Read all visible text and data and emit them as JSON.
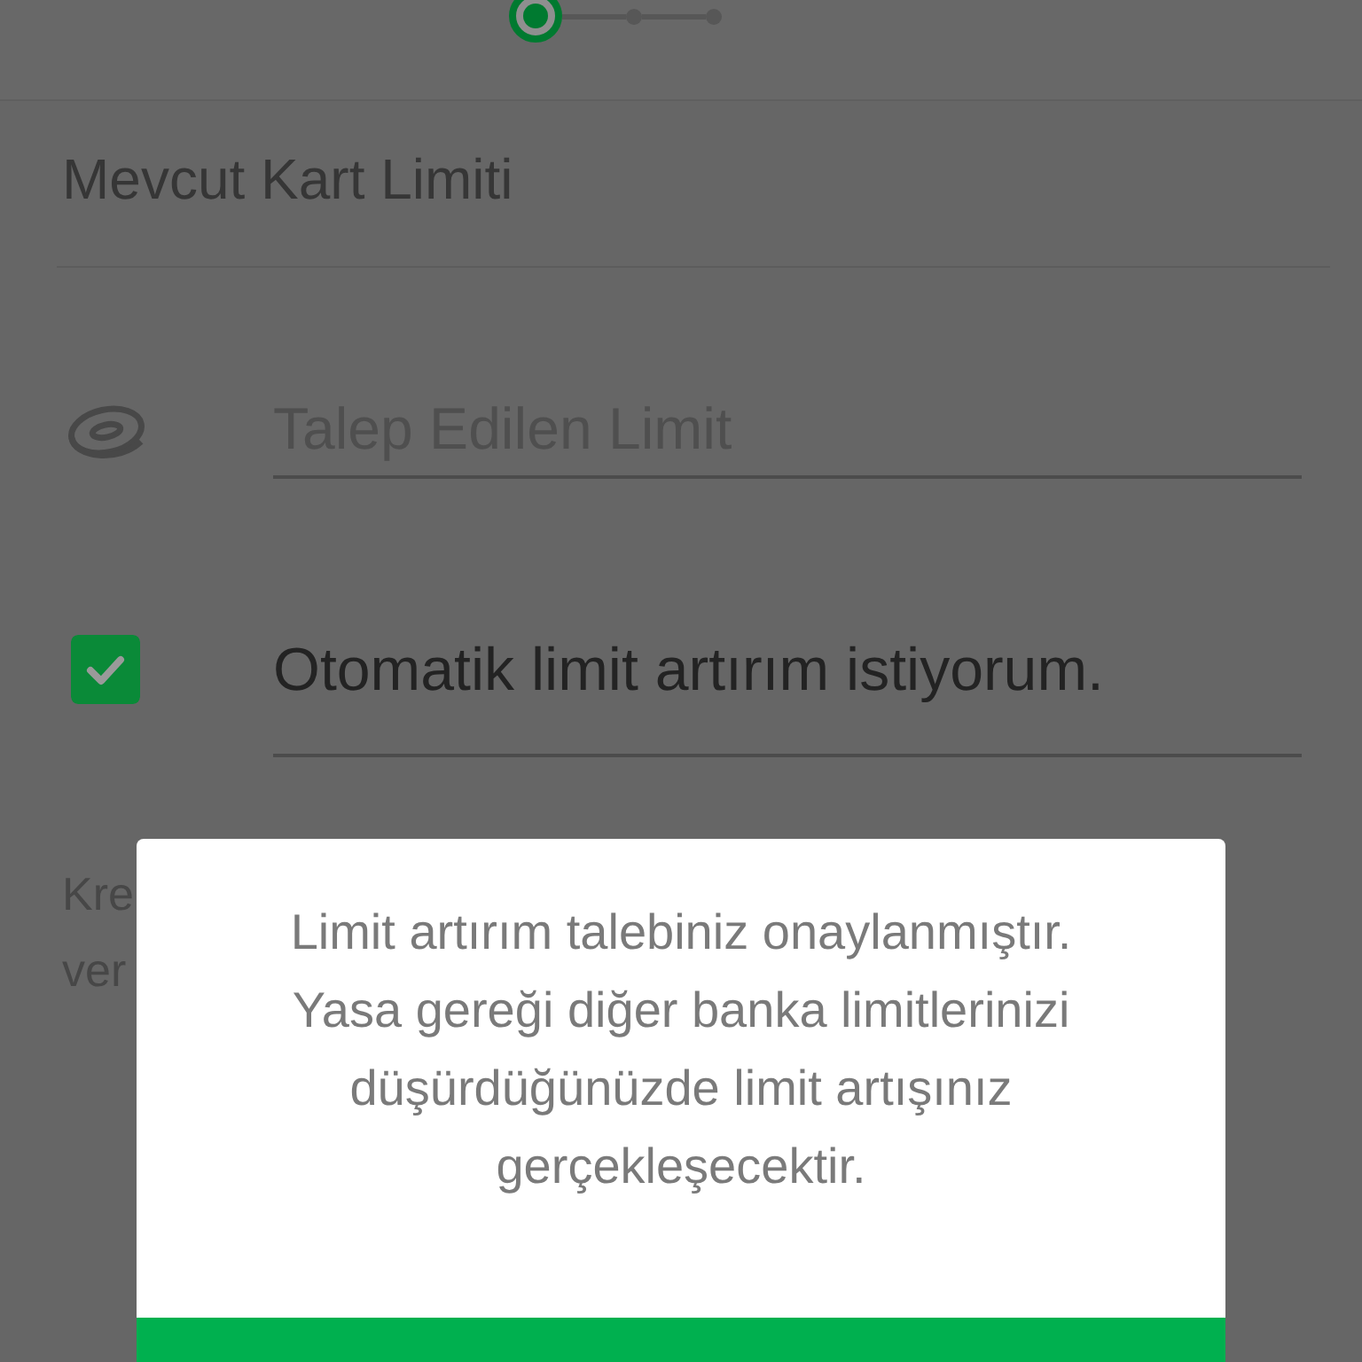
{
  "stepper": {
    "steps": [
      {
        "selected": true
      },
      {
        "selected": false
      },
      {
        "selected": false
      }
    ]
  },
  "current_limit": {
    "label": "Mevcut Kart Limiti"
  },
  "requested_limit": {
    "placeholder": "Talep Edilen Limit"
  },
  "auto_limit": {
    "label": "Otomatik limit artırım istiyorum.",
    "checked": true
  },
  "note": {
    "lines": [
      "Kre",
      "ver"
    ]
  },
  "dialog": {
    "message": "Limit artırım talebiniz onaylanmıştır. Yasa gereği diğer banka limitlerinizi düşürdüğünüzde limit artışınız gerçekleşecektir."
  }
}
